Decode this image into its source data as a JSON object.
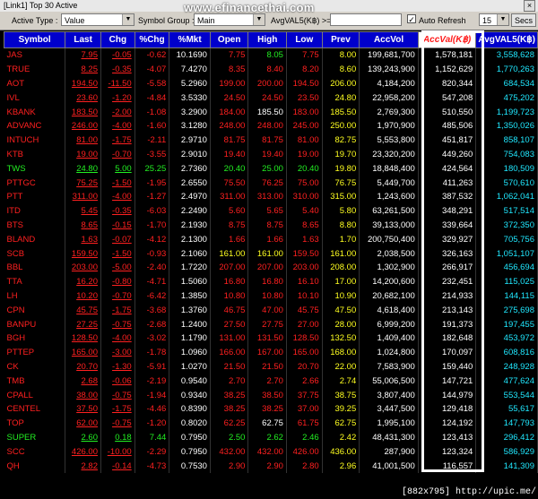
{
  "window": {
    "title": "[Link1] Top 30 Active",
    "close_glyph": "×"
  },
  "watermark": "www.efinancethai.com",
  "toolbar": {
    "active_type_label": "Active Type :",
    "active_type_value": "Value",
    "symbol_group_label": "Symbol Group :",
    "symbol_group_value": "Main",
    "avgval_label": "AvgVAL5(K฿) >=",
    "avgval_value": "",
    "auto_refresh_label": "Auto Refresh",
    "auto_refresh_checked": "✓",
    "refresh_interval": "15",
    "secs_button": "Secs"
  },
  "columns": [
    "Symbol",
    "Last",
    "Chg",
    "%Chg",
    "%Mkt",
    "Open",
    "High",
    "Low",
    "Prev",
    "AccVol",
    "AccVal(K฿)",
    "AvgVAL5(K฿)"
  ],
  "rows": [
    {
      "c": "r",
      "s": "JAS",
      "last": "7.95",
      "chg": "-0.05",
      "pchg": "-0.62",
      "mkt": "10.1690",
      "open": "7.75",
      "oc": "r",
      "high": "8.05",
      "hc": "g",
      "low": "7.75",
      "lc": "r",
      "prev": "8.00",
      "vol": "199,681,700",
      "val": "1,578,181",
      "avg": "3,558,628"
    },
    {
      "c": "r",
      "s": "TRUE",
      "last": "8.25",
      "chg": "-0.35",
      "pchg": "-4.07",
      "mkt": "7.4270",
      "open": "8.35",
      "oc": "r",
      "high": "8.40",
      "hc": "r",
      "low": "8.20",
      "lc": "r",
      "prev": "8.60",
      "vol": "139,243,900",
      "val": "1,152,629",
      "avg": "1,770,263"
    },
    {
      "c": "r",
      "s": "AOT",
      "last": "194.50",
      "chg": "-11.50",
      "pchg": "-5.58",
      "mkt": "5.2960",
      "open": "199.00",
      "oc": "r",
      "high": "200.00",
      "hc": "r",
      "low": "194.50",
      "lc": "r",
      "prev": "206.00",
      "vol": "4,184,200",
      "val": "820,344",
      "avg": "684,534"
    },
    {
      "c": "r",
      "s": "IVL",
      "last": "23.60",
      "chg": "-1.20",
      "pchg": "-4.84",
      "mkt": "3.5330",
      "open": "24.50",
      "oc": "r",
      "high": "24.50",
      "hc": "r",
      "low": "23.50",
      "lc": "r",
      "prev": "24.80",
      "vol": "22,958,200",
      "val": "547,208",
      "avg": "475,202"
    },
    {
      "c": "r",
      "s": "KBANK",
      "last": "183.50",
      "chg": "-2.00",
      "pchg": "-1.08",
      "mkt": "3.2900",
      "open": "184.00",
      "oc": "r",
      "high": "185.50",
      "hc": "w",
      "low": "183.00",
      "lc": "r",
      "prev": "185.50",
      "vol": "2,769,300",
      "val": "510,550",
      "avg": "1,199,723"
    },
    {
      "c": "r",
      "s": "ADVANC",
      "last": "246.00",
      "chg": "-4.00",
      "pchg": "-1.60",
      "mkt": "3.1280",
      "open": "248.00",
      "oc": "r",
      "high": "248.00",
      "hc": "r",
      "low": "245.00",
      "lc": "r",
      "prev": "250.00",
      "vol": "1,970,900",
      "val": "485,506",
      "avg": "1,350,026"
    },
    {
      "c": "r",
      "s": "INTUCH",
      "last": "81.00",
      "chg": "-1.75",
      "pchg": "-2.11",
      "mkt": "2.9710",
      "open": "81.75",
      "oc": "r",
      "high": "81.75",
      "hc": "r",
      "low": "81.00",
      "lc": "r",
      "prev": "82.75",
      "vol": "5,553,800",
      "val": "451,817",
      "avg": "858,107"
    },
    {
      "c": "r",
      "s": "KTB",
      "last": "19.00",
      "chg": "-0.70",
      "pchg": "-3.55",
      "mkt": "2.9010",
      "open": "19.40",
      "oc": "r",
      "high": "19.40",
      "hc": "r",
      "low": "19.00",
      "lc": "r",
      "prev": "19.70",
      "vol": "23,320,200",
      "val": "449,260",
      "avg": "754,083"
    },
    {
      "c": "g",
      "s": "TWS",
      "last": "24.80",
      "chg": "5.00",
      "pchg": "25.25",
      "mkt": "2.7360",
      "open": "20.40",
      "oc": "g",
      "high": "25.00",
      "hc": "g",
      "low": "20.40",
      "lc": "g",
      "prev": "19.80",
      "vol": "18,848,400",
      "val": "424,564",
      "avg": "180,509"
    },
    {
      "c": "r",
      "s": "PTTGC",
      "last": "75.25",
      "chg": "-1.50",
      "pchg": "-1.95",
      "mkt": "2.6550",
      "open": "75.50",
      "oc": "r",
      "high": "76.25",
      "hc": "r",
      "low": "75.00",
      "lc": "r",
      "prev": "76.75",
      "vol": "5,449,700",
      "val": "411,263",
      "avg": "570,610"
    },
    {
      "c": "r",
      "s": "PTT",
      "last": "311.00",
      "chg": "-4.00",
      "pchg": "-1.27",
      "mkt": "2.4970",
      "open": "311.00",
      "oc": "r",
      "high": "313.00",
      "hc": "r",
      "low": "310.00",
      "lc": "r",
      "prev": "315.00",
      "vol": "1,243,600",
      "val": "387,532",
      "avg": "1,062,041"
    },
    {
      "c": "r",
      "s": "ITD",
      "last": "5.45",
      "chg": "-0.35",
      "pchg": "-6.03",
      "mkt": "2.2490",
      "open": "5.60",
      "oc": "r",
      "high": "5.65",
      "hc": "r",
      "low": "5.40",
      "lc": "r",
      "prev": "5.80",
      "vol": "63,261,500",
      "val": "348,291",
      "avg": "517,514"
    },
    {
      "c": "r",
      "s": "BTS",
      "last": "8.65",
      "chg": "-0.15",
      "pchg": "-1.70",
      "mkt": "2.1930",
      "open": "8.75",
      "oc": "r",
      "high": "8.75",
      "hc": "r",
      "low": "8.65",
      "lc": "r",
      "prev": "8.80",
      "vol": "39,133,000",
      "val": "339,664",
      "avg": "372,350"
    },
    {
      "c": "r",
      "s": "BLAND",
      "last": "1.63",
      "chg": "-0.07",
      "pchg": "-4.12",
      "mkt": "2.1300",
      "open": "1.66",
      "oc": "r",
      "high": "1.66",
      "hc": "r",
      "low": "1.63",
      "lc": "r",
      "prev": "1.70",
      "vol": "200,750,400",
      "val": "329,927",
      "avg": "705,756"
    },
    {
      "c": "r",
      "s": "SCB",
      "last": "159.50",
      "chg": "-1.50",
      "pchg": "-0.93",
      "mkt": "2.1060",
      "open": "161.00",
      "oc": "y",
      "high": "161.00",
      "hc": "y",
      "low": "159.50",
      "lc": "r",
      "prev": "161.00",
      "vol": "2,038,500",
      "val": "326,163",
      "avg": "1,051,107"
    },
    {
      "c": "r",
      "s": "BBL",
      "last": "203.00",
      "chg": "-5.00",
      "pchg": "-2.40",
      "mkt": "1.7220",
      "open": "207.00",
      "oc": "r",
      "high": "207.00",
      "hc": "r",
      "low": "203.00",
      "lc": "r",
      "prev": "208.00",
      "vol": "1,302,900",
      "val": "266,917",
      "avg": "456,694"
    },
    {
      "c": "r",
      "s": "TTA",
      "last": "16.20",
      "chg": "-0.80",
      "pchg": "-4.71",
      "mkt": "1.5060",
      "open": "16.80",
      "oc": "r",
      "high": "16.80",
      "hc": "r",
      "low": "16.10",
      "lc": "r",
      "prev": "17.00",
      "vol": "14,200,600",
      "val": "232,451",
      "avg": "115,025"
    },
    {
      "c": "r",
      "s": "LH",
      "last": "10.20",
      "chg": "-0.70",
      "pchg": "-6.42",
      "mkt": "1.3850",
      "open": "10.80",
      "oc": "r",
      "high": "10.80",
      "hc": "r",
      "low": "10.10",
      "lc": "r",
      "prev": "10.90",
      "vol": "20,682,100",
      "val": "214,933",
      "avg": "144,115"
    },
    {
      "c": "r",
      "s": "CPN",
      "last": "45.75",
      "chg": "-1.75",
      "pchg": "-3.68",
      "mkt": "1.3760",
      "open": "46.75",
      "oc": "r",
      "high": "47.00",
      "hc": "r",
      "low": "45.75",
      "lc": "r",
      "prev": "47.50",
      "vol": "4,618,400",
      "val": "213,143",
      "avg": "275,698"
    },
    {
      "c": "r",
      "s": "BANPU",
      "last": "27.25",
      "chg": "-0.75",
      "pchg": "-2.68",
      "mkt": "1.2400",
      "open": "27.50",
      "oc": "r",
      "high": "27.75",
      "hc": "r",
      "low": "27.00",
      "lc": "r",
      "prev": "28.00",
      "vol": "6,999,200",
      "val": "191,373",
      "avg": "197,455"
    },
    {
      "c": "r",
      "s": "BGH",
      "last": "128.50",
      "chg": "-4.00",
      "pchg": "-3.02",
      "mkt": "1.1790",
      "open": "131.00",
      "oc": "r",
      "high": "131.50",
      "hc": "r",
      "low": "128.50",
      "lc": "r",
      "prev": "132.50",
      "vol": "1,409,400",
      "val": "182,648",
      "avg": "453,972"
    },
    {
      "c": "r",
      "s": "PTTEP",
      "last": "165.00",
      "chg": "-3.00",
      "pchg": "-1.78",
      "mkt": "1.0960",
      "open": "166.00",
      "oc": "r",
      "high": "167.00",
      "hc": "r",
      "low": "165.00",
      "lc": "r",
      "prev": "168.00",
      "vol": "1,024,800",
      "val": "170,097",
      "avg": "608,816"
    },
    {
      "c": "r",
      "s": "CK",
      "last": "20.70",
      "chg": "-1.30",
      "pchg": "-5.91",
      "mkt": "1.0270",
      "open": "21.50",
      "oc": "r",
      "high": "21.50",
      "hc": "r",
      "low": "20.70",
      "lc": "r",
      "prev": "22.00",
      "vol": "7,583,900",
      "val": "159,440",
      "avg": "248,928"
    },
    {
      "c": "r",
      "s": "TMB",
      "last": "2.68",
      "chg": "-0.06",
      "pchg": "-2.19",
      "mkt": "0.9540",
      "open": "2.70",
      "oc": "r",
      "high": "2.70",
      "hc": "r",
      "low": "2.66",
      "lc": "r",
      "prev": "2.74",
      "vol": "55,006,500",
      "val": "147,721",
      "avg": "477,624"
    },
    {
      "c": "r",
      "s": "CPALL",
      "last": "38.00",
      "chg": "-0.75",
      "pchg": "-1.94",
      "mkt": "0.9340",
      "open": "38.25",
      "oc": "r",
      "high": "38.50",
      "hc": "r",
      "low": "37.75",
      "lc": "r",
      "prev": "38.75",
      "vol": "3,807,400",
      "val": "144,979",
      "avg": "553,544"
    },
    {
      "c": "r",
      "s": "CENTEL",
      "last": "37.50",
      "chg": "-1.75",
      "pchg": "-4.46",
      "mkt": "0.8390",
      "open": "38.25",
      "oc": "r",
      "high": "38.25",
      "hc": "r",
      "low": "37.00",
      "lc": "r",
      "prev": "39.25",
      "vol": "3,447,500",
      "val": "129,418",
      "avg": "55,617"
    },
    {
      "c": "r",
      "s": "TOP",
      "last": "62.00",
      "chg": "-0.75",
      "pchg": "-1.20",
      "mkt": "0.8020",
      "open": "62.25",
      "oc": "r",
      "high": "62.75",
      "hc": "w",
      "low": "61.75",
      "lc": "r",
      "prev": "62.75",
      "vol": "1,995,100",
      "val": "124,192",
      "avg": "147,793"
    },
    {
      "c": "g",
      "s": "SUPER",
      "last": "2.60",
      "chg": "0.18",
      "pchg": "7.44",
      "mkt": "0.7950",
      "open": "2.50",
      "oc": "g",
      "high": "2.62",
      "hc": "g",
      "low": "2.46",
      "lc": "g",
      "prev": "2.42",
      "vol": "48,431,300",
      "val": "123,413",
      "avg": "296,412"
    },
    {
      "c": "r",
      "s": "SCC",
      "last": "426.00",
      "chg": "-10.00",
      "pchg": "-2.29",
      "mkt": "0.7950",
      "open": "432.00",
      "oc": "r",
      "high": "432.00",
      "hc": "r",
      "low": "426.00",
      "lc": "r",
      "prev": "436.00",
      "vol": "287,900",
      "val": "123,324",
      "avg": "586,929"
    },
    {
      "c": "r",
      "s": "QH",
      "last": "2.82",
      "chg": "-0.14",
      "pchg": "-4.73",
      "mkt": "0.7530",
      "open": "2.90",
      "oc": "r",
      "high": "2.90",
      "hc": "r",
      "low": "2.80",
      "lc": "r",
      "prev": "2.96",
      "vol": "41,001,500",
      "val": "116,557",
      "avg": "141,309"
    }
  ],
  "footer": "[882x795] http://upic.me/",
  "colors": {
    "header_bg": "#0000cc",
    "down": "#ff2020",
    "up": "#22ee22",
    "unchanged": "#ffff20",
    "avg": "#20e8ff",
    "accval_header": "#ff1a1a"
  }
}
